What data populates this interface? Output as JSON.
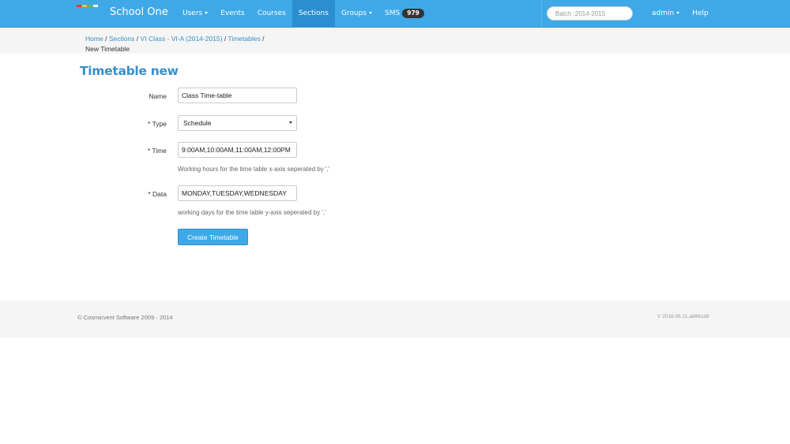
{
  "colors": {
    "navbar": "#3fa9e8",
    "navbar_active": "#2a8ed0",
    "link": "#3a8ec8",
    "badge": "#333333",
    "logo": [
      "#e03b3b",
      "#f2c12e",
      "#5cb85c",
      "#ffffff"
    ]
  },
  "navbar": {
    "brand": "School One",
    "items": [
      {
        "label": "Users",
        "dropdown": true
      },
      {
        "label": "Events",
        "dropdown": false
      },
      {
        "label": "Courses",
        "dropdown": false
      },
      {
        "label": "Sections",
        "dropdown": false,
        "active": true
      },
      {
        "label": "Groups",
        "dropdown": true
      },
      {
        "label": "SMS",
        "badge": "979"
      }
    ],
    "search_placeholder": "Batch :2014-2015",
    "right": [
      {
        "label": "admin",
        "dropdown": true
      },
      {
        "label": "Help",
        "dropdown": false
      }
    ]
  },
  "breadcrumb": {
    "items": [
      "Home",
      "Sections",
      "VI Class - VI-A (2014-2015)",
      "Timetables"
    ],
    "separator": "/",
    "current": "New Timetable"
  },
  "page": {
    "title": "Timetable new"
  },
  "form": {
    "name_label": "Name",
    "name_value": "Class Time-table",
    "type_label": "Type",
    "type_value": "Schedule",
    "time_label": "Time",
    "time_value": "9:00AM,10:00AM,11:00AM,12:00PM",
    "time_help": "Working hours for the time table x-axis seperated by ','",
    "data_label": "Data",
    "data_value": "MONDAY,TUESDAY,WEDNESDAY",
    "data_help": "working days for the time table y-axis seperated by ','",
    "required_mark": "*",
    "submit_label": "Create Timetable"
  },
  "footer": {
    "copyright": "© Cosmicvent Software 2009 - 2014",
    "version": "V 2016.06.21.a6961d9"
  }
}
